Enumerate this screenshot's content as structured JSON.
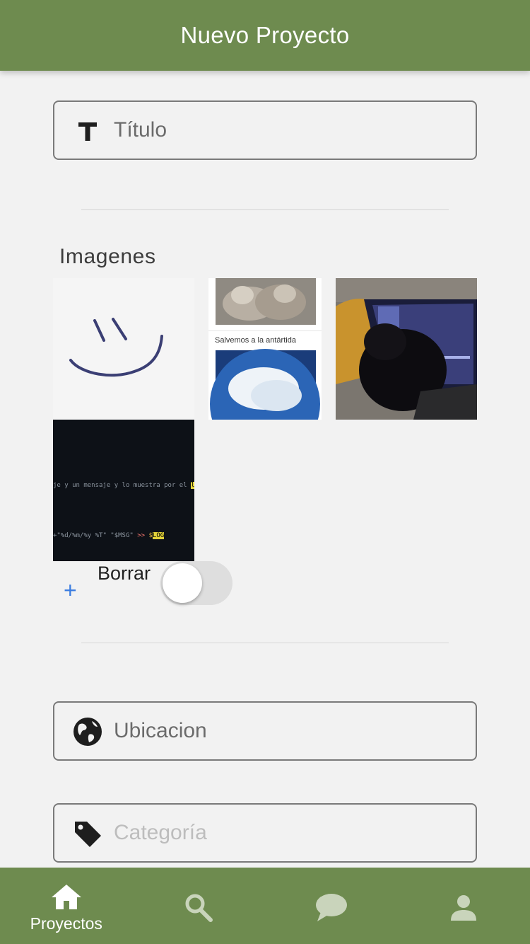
{
  "header": {
    "title": "Nuevo Proyecto"
  },
  "title_field": {
    "placeholder": "Título",
    "icon": "text-icon"
  },
  "images": {
    "section_title": "Imagenes",
    "items": [
      {
        "name": "smiley-drawing"
      },
      {
        "name": "kittens-antarctica-post",
        "caption": "Salvemos a la antártida"
      },
      {
        "name": "black-cat-laptop"
      },
      {
        "name": "terminal-code",
        "line1": "je y un mensaje y lo muestra por el",
        "line1_hl": "log",
        "line2": "+\"%d/%m/%y %T\" \"$MSG\"",
        "line2_op": ">>",
        "line2_var": "$",
        "line2_hl": "LOG"
      }
    ],
    "add_label": "+",
    "delete_label": "Borrar",
    "delete_toggle_on": false
  },
  "location_field": {
    "placeholder": "Ubicacion",
    "icon": "globe-icon"
  },
  "category_field": {
    "placeholder": "Categoría",
    "icon": "tag-icon"
  },
  "tabs": [
    {
      "name": "home",
      "label": "Proyectos",
      "icon": "home-icon",
      "active": true
    },
    {
      "name": "search",
      "label": "",
      "icon": "search-icon",
      "active": false
    },
    {
      "name": "chat",
      "label": "",
      "icon": "chat-icon",
      "active": false
    },
    {
      "name": "profile",
      "label": "",
      "icon": "user-icon",
      "active": false
    }
  ],
  "colors": {
    "brand": "#6e8b4f",
    "background": "#f2f2f2",
    "accent": "#3b7de0"
  }
}
